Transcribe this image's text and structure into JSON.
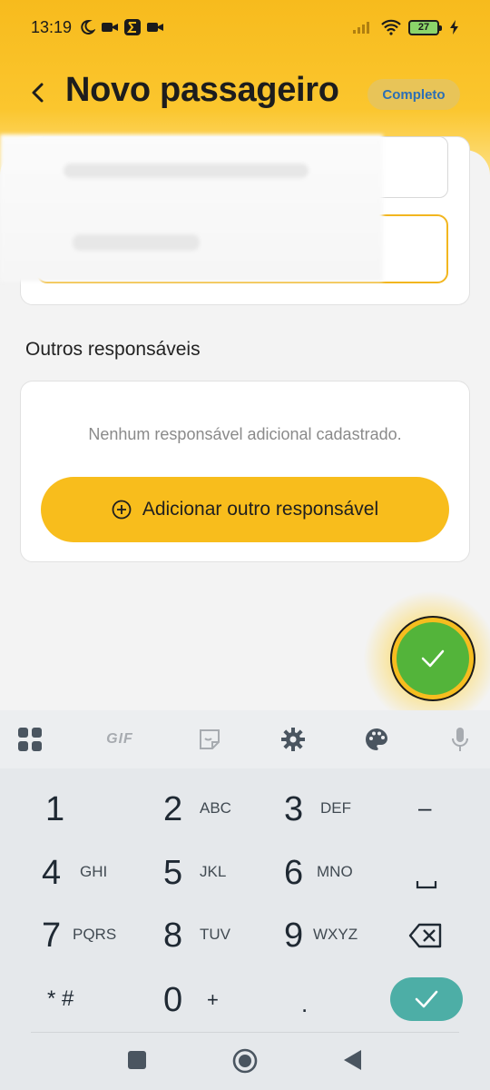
{
  "status_bar": {
    "time": "13:19",
    "battery": "27",
    "icons": [
      "moon-icon",
      "video-camera-icon",
      "sigma-app-icon",
      "video-camera-icon",
      "signal-icon",
      "wifi-icon",
      "battery-icon",
      "charging-icon"
    ]
  },
  "header": {
    "back_icon": "chevron-left-icon",
    "title": "Novo passageiro",
    "status_chip": "Completo"
  },
  "responsibles": {
    "section_title": "Outros responsáveis",
    "empty_message": "Nenhum responsável adicional cadastrado.",
    "add_button_label": "Adicionar outro responsável",
    "add_icon": "plus-circle-icon"
  },
  "fab": {
    "icon": "check-icon"
  },
  "keyboard": {
    "toolbar": [
      "apps-grid-icon",
      "GIF",
      "sticker-icon",
      "gear-icon",
      "palette-icon",
      "microphone-icon"
    ],
    "gif_label": "GIF",
    "keys": [
      {
        "num": "1",
        "letters": ""
      },
      {
        "num": "2",
        "letters": "ABC"
      },
      {
        "num": "3",
        "letters": "DEF"
      },
      {
        "num": "4",
        "letters": "GHI"
      },
      {
        "num": "5",
        "letters": "JKL"
      },
      {
        "num": "6",
        "letters": "MNO"
      },
      {
        "num": "7",
        "letters": "PQRS"
      },
      {
        "num": "8",
        "letters": "TUV"
      },
      {
        "num": "9",
        "letters": "WXYZ"
      },
      {
        "num": "0",
        "letters": "+"
      }
    ],
    "symbols": {
      "minus": "–",
      "star_hash": "* #",
      "period": "."
    },
    "done_icon": "check-icon",
    "backspace_icon": "backspace-icon",
    "space_icon": "space-icon"
  },
  "nav_bar": [
    "recents-square-icon",
    "home-circle-icon",
    "back-triangle-icon"
  ],
  "colors": {
    "brand_yellow": "#f8bd1c",
    "fab_green": "#53b43a",
    "done_teal": "#4daea6",
    "chip_text": "#2c6fb5"
  }
}
